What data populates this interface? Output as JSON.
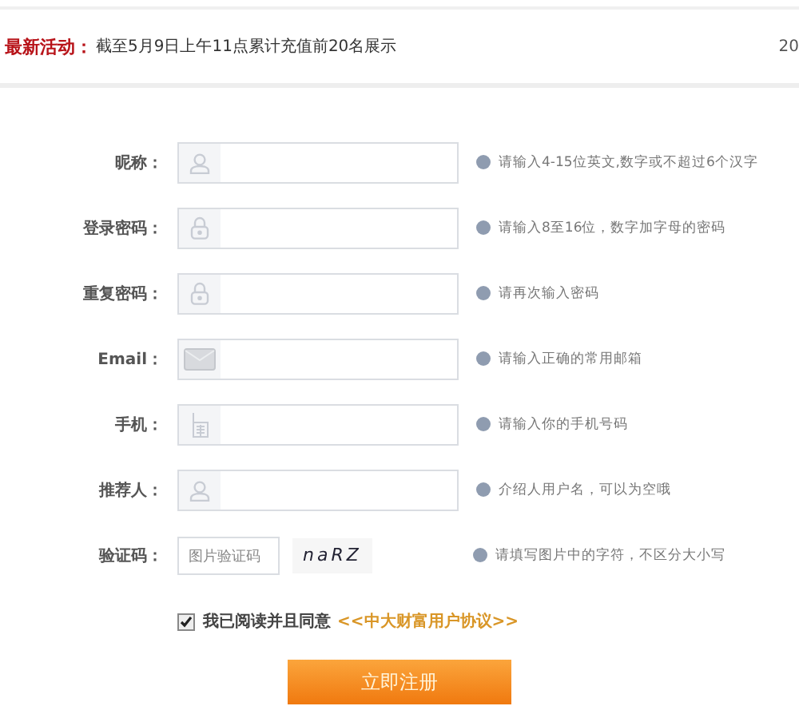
{
  "notice": {
    "label": "最新活动：",
    "text": "截至5月9日上午11点累计充值前20名展示",
    "date": "20"
  },
  "fields": [
    {
      "label": "昵称：",
      "kind": "user",
      "hint": "请输入4-15位英文,数字或不超过6个汉字"
    },
    {
      "label": "登录密码：",
      "kind": "lock",
      "hint": "请输入8至16位，数字加字母的密码"
    },
    {
      "label": "重复密码：",
      "kind": "lock",
      "hint": "请再次输入密码"
    },
    {
      "label": "Email：",
      "kind": "mail",
      "hint": "请输入正确的常用邮箱"
    },
    {
      "label": "手机：",
      "kind": "phone",
      "hint": "请输入你的手机号码"
    },
    {
      "label": "推荐人：",
      "kind": "user",
      "hint": "介绍人用户名，可以为空哦"
    }
  ],
  "captcha": {
    "label": "验证码：",
    "placeholder": "图片验证码",
    "code": "naRZ",
    "hint": "请填写图片中的字符，不区分大小写"
  },
  "agreement": {
    "checked": true,
    "text": "我已阅读并且同意",
    "link": "<<中大财富用户协议>>"
  },
  "submit": "立即注册"
}
